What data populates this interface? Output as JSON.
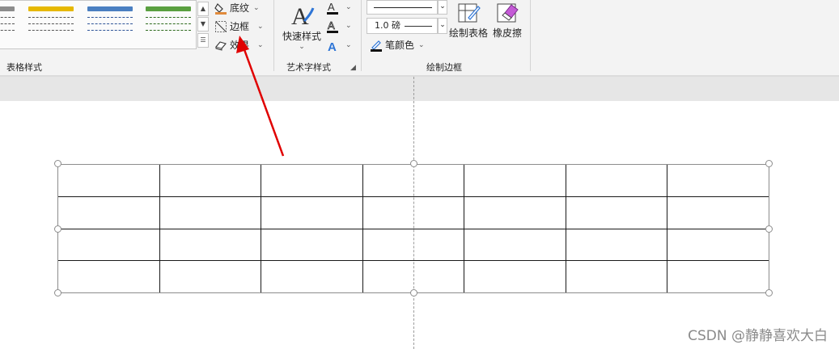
{
  "ribbon": {
    "groups": {
      "table_styles": {
        "label": "表格样式"
      },
      "wordart_styles": {
        "label": "艺术字样式"
      },
      "draw_borders": {
        "label": "绘制边框"
      }
    },
    "commands": {
      "shading": "底纹",
      "borders": "边框",
      "effects": "效果",
      "quick_styles": "快速样式",
      "pen_color": "笔颜色",
      "draw_table": "绘制表格",
      "eraser": "橡皮擦"
    },
    "pen_weight": "1.0 磅",
    "style_colors": [
      "#8c8c8c",
      "#e6b800",
      "#4a7fc1",
      "#5aa040"
    ],
    "accent_colors": {
      "shading_bar": "#e08a3c",
      "text_fill_blue": "#2e75d6",
      "pen_red": "#e00000"
    }
  },
  "table": {
    "rows": 4,
    "columns": 7
  },
  "watermark": "CSDN @静静喜欢大白"
}
